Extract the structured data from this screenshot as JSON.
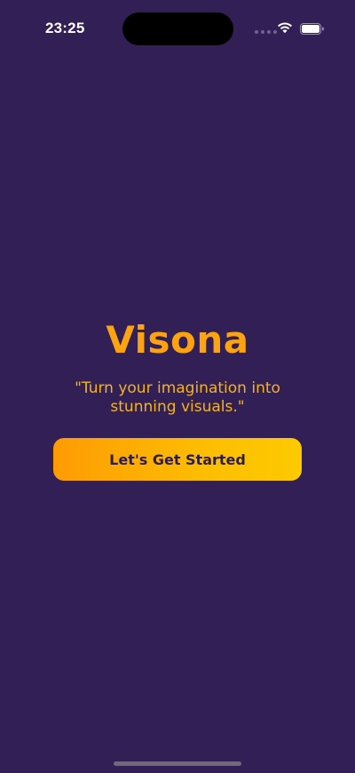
{
  "status_bar": {
    "time": "23:25",
    "icons": [
      "cellular-signal-icon",
      "wifi-icon",
      "battery-icon"
    ]
  },
  "welcome": {
    "title": "Visona",
    "tagline": "\"Turn your imagination into stunning visuals.\"",
    "cta_label": "Let's Get Started"
  },
  "colors": {
    "background": "#311f55",
    "accent": "#fca311",
    "tagline": "#f6b418",
    "button_gradient_start": "#fe9b04",
    "button_gradient_end": "#fdca00",
    "button_text": "#2d1d4d"
  }
}
